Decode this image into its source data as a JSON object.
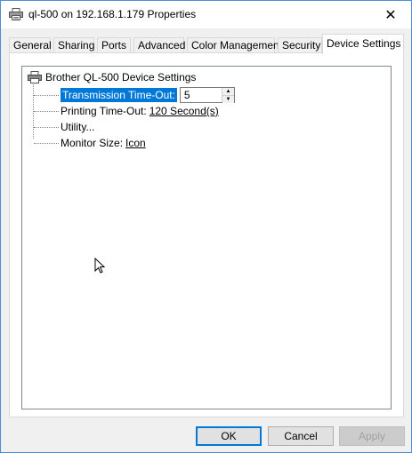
{
  "window": {
    "title": "ql-500 on 192.168.1.179 Properties",
    "close_glyph": "✕"
  },
  "tabs": [
    {
      "label": "General"
    },
    {
      "label": "Sharing"
    },
    {
      "label": "Ports"
    },
    {
      "label": "Advanced"
    },
    {
      "label": "Color Management"
    },
    {
      "label": "Security"
    },
    {
      "label": "Device Settings",
      "active": true
    }
  ],
  "tree": {
    "root_label": "Brother QL-500 Device Settings",
    "items": [
      {
        "label": "Transmission Time-Out:",
        "value": "5",
        "selected": true
      },
      {
        "label": "Printing Time-Out:",
        "value": "120 Second(s)"
      },
      {
        "label": "Utility..."
      },
      {
        "label": "Monitor Size:",
        "value": "Icon"
      }
    ]
  },
  "buttons": {
    "ok": "OK",
    "cancel": "Cancel",
    "apply": "Apply"
  },
  "colors": {
    "selection": "#0078d7",
    "accent_border": "#4a90d9"
  },
  "icons": {
    "title": "printer-icon",
    "root": "printer-icon",
    "close": "close-icon",
    "cursor": "mouse-pointer-icon"
  }
}
